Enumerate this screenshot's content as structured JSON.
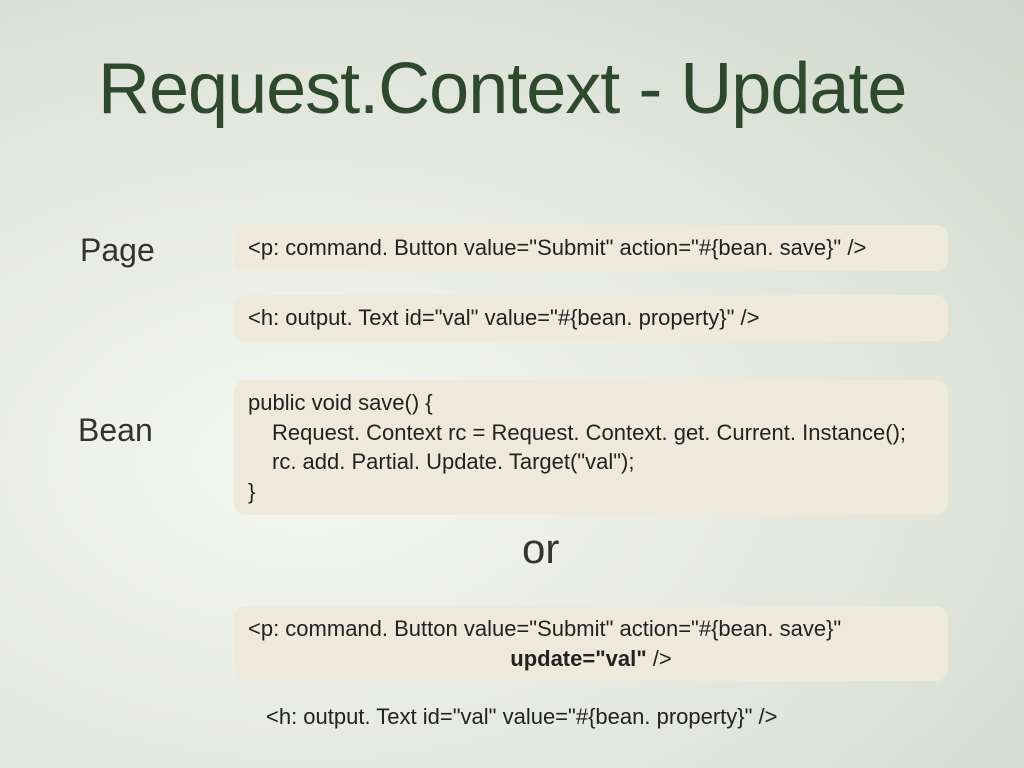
{
  "title": "Request.Context - Update",
  "labels": {
    "page": "Page",
    "bean": "Bean",
    "or": "or"
  },
  "code": {
    "page1": "<p: command. Button value=\"Submit\" action=\"#{bean. save}\" />",
    "page2": "<h: output. Text id=\"val\" value=\"#{bean. property}\" />",
    "bean_line1": "public void save() {",
    "bean_line2": "Request. Context rc = Request. Context. get. Current. Instance();",
    "bean_line3": "rc. add. Partial. Update. Target(\"val\");",
    "bean_line4": "}",
    "alt_line1": "<p: command. Button value=\"Submit\" action=\"#{bean. save}\"",
    "alt_line2_bold": "update=\"val\"",
    "alt_line2_tail": " />",
    "alt_out": "<h: output. Text id=\"val\" value=\"#{bean. property}\" />"
  }
}
